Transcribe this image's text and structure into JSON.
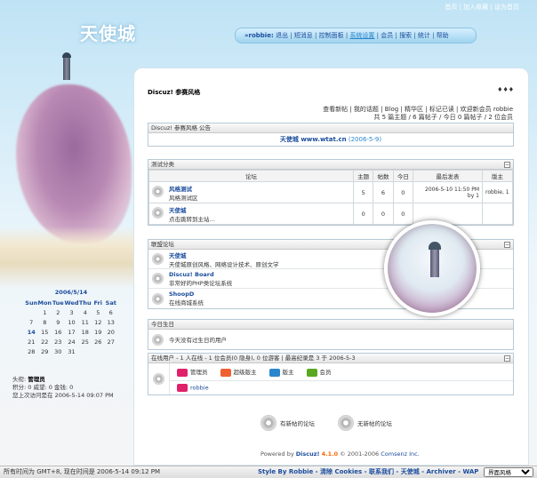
{
  "toplinks": [
    "首页",
    "加入收藏",
    "设为首页"
  ],
  "logo": "天使城",
  "nav": {
    "user": "»robbie:",
    "items": [
      "退出",
      "短消息",
      "控制面板",
      "系统设置",
      "会员",
      "搜索",
      "统计",
      "帮助"
    ]
  },
  "calendar": {
    "title": "2006/5/14",
    "days": [
      "Sun",
      "Mon",
      "Tue",
      "Wed",
      "Thu",
      "Fri",
      "Sat"
    ],
    "cells": [
      "",
      "1",
      "2",
      "3",
      "4",
      "5",
      "6",
      "7",
      "8",
      "9",
      "10",
      "11",
      "12",
      "13",
      "14",
      "15",
      "16",
      "17",
      "18",
      "19",
      "20",
      "21",
      "22",
      "23",
      "24",
      "25",
      "26",
      "27",
      "28",
      "29",
      "30",
      "31",
      "",
      "",
      ""
    ]
  },
  "userinfo": {
    "title_label": "头衔:",
    "title_value": "管理员",
    "points": "积分: 0  威望: 0  金钱: 0",
    "last_visit": "您上次访问是在 2006-5-14 09:07 PM"
  },
  "breadcrumb": "Discuz! 参赛风格",
  "breadcrumb_dots": "♦♦♦",
  "quicklinks": {
    "line1": "查看新帖 | 我的话题 | Blog | 精华区 | 标记已读 | 欢迎新会员 robbie",
    "line2": "共 5 篇主题 / 6 篇帖子 / 今日 0 篇帖子 / 2 位会员"
  },
  "announce": {
    "header": "Discuz! 参赛风格 公告",
    "text": "天使城 www.wtat.cn",
    "date": "(2006-5-9)"
  },
  "category1": {
    "header": "测试分类",
    "columns": [
      "论坛",
      "主题",
      "帖数",
      "今日",
      "最后发表",
      "版主"
    ],
    "rows": [
      {
        "name": "风格测试",
        "desc": "风格测试区",
        "topics": "5",
        "posts": "6",
        "today": "0",
        "last": "2006-5-10 11:50 PM",
        "by": "by 1",
        "mods": "robbie, 1"
      },
      {
        "name": "天使城",
        "desc": "点击跳转到主站…",
        "topics": "0",
        "posts": "0",
        "today": "0",
        "last": "",
        "by": "",
        "mods": ""
      }
    ]
  },
  "category2": {
    "header": "联盟论坛",
    "rows": [
      {
        "name": "天使城",
        "desc": "天使城原创风格、网络设计技术、原创文学"
      },
      {
        "name": "Discuz! Board",
        "desc": "非常好的PHP类论坛系统"
      },
      {
        "name": "ShoopD",
        "desc": "在线商城系统"
      }
    ]
  },
  "birthday": {
    "header": "今日生日",
    "text": "今天没有过生日的用户"
  },
  "online": {
    "header": "在线用户 - 1 人在线 - 1 位会员(0 隐身), 0 位游客 | 最高纪录是 3 于 2006-5-3",
    "legend": [
      "管理员",
      "超级版主",
      "版主",
      "会员"
    ],
    "legend_colors": [
      "#e0206a",
      "#f06030",
      "#2a86cc",
      "#5aa820"
    ],
    "user": "robbie"
  },
  "bottom": {
    "new": "有新帖的论坛",
    "nonew": "无新帖的论坛"
  },
  "powered": {
    "prefix": "Powered by",
    "name": "Discuz!",
    "version": "4.1.0",
    "copy": "© 2001-2006",
    "company": "Comsenz Inc."
  },
  "footer": {
    "time": "所有时间为 GMT+8, 现在时间是 2006-5-14 09:12 PM",
    "links": "Style By Robbie - 清除 Cookies - 联系我们 - 天使城 - Archiver - WAP",
    "style_select": "界面风格"
  }
}
